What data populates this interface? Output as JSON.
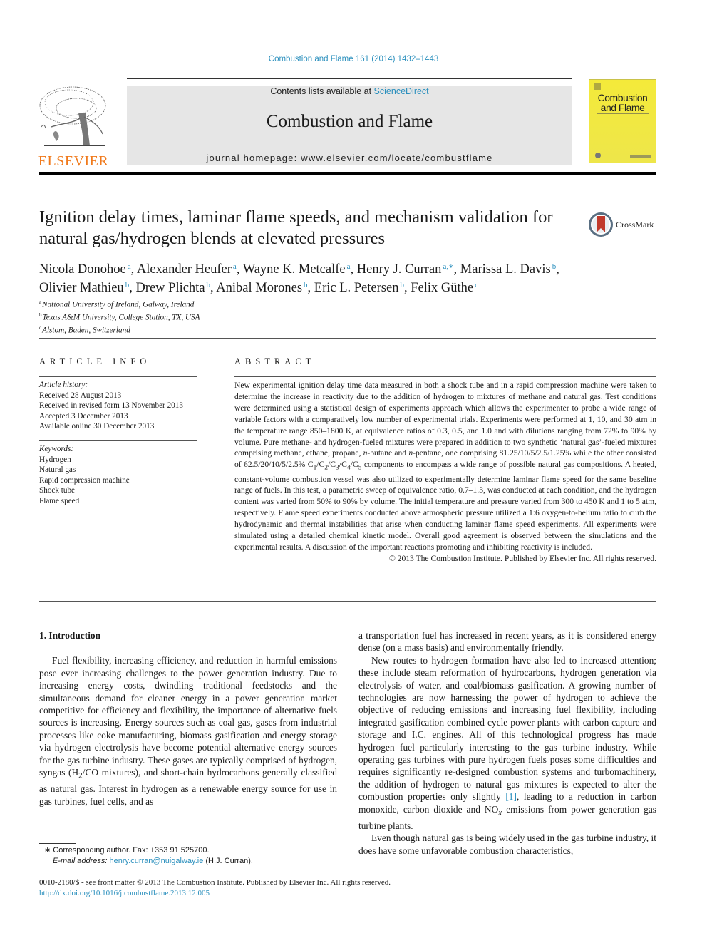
{
  "header": {
    "citation": "Combustion and Flame 161 (2014) 1432–1443",
    "publisher_logo_text": "ELSEVIER",
    "contents_prefix": "Contents lists available at ",
    "contents_link": "ScienceDirect",
    "journal_title": "Combustion and Flame",
    "homepage": "journal homepage: www.elsevier.com/locate/combustflame",
    "cover_title_line1": "Combustion",
    "cover_title_line2": "and Flame",
    "crossmark_label": "CrossMark",
    "colors": {
      "link": "#2a8fbd",
      "elsevier_orange": "#f07a1c",
      "cover_yellow": "#f4ea3a",
      "masthead_gray": "#e6e6e6"
    }
  },
  "article": {
    "title": "Ignition delay times, laminar flame speeds, and mechanism validation for natural gas/hydrogen blends at elevated pressures",
    "authors": [
      {
        "name": "Nicola Donohoe",
        "aff": "a",
        "sep": ", "
      },
      {
        "name": "Alexander Heufer",
        "aff": "a",
        "sep": ", "
      },
      {
        "name": "Wayne K. Metcalfe",
        "aff": "a",
        "sep": ", "
      },
      {
        "name": "Henry J. Curran",
        "aff": "a,∗",
        "sep": ", "
      },
      {
        "name": "Marissa L. Davis",
        "aff": "b",
        "sep": ","
      },
      {
        "name": "Olivier Mathieu",
        "aff": "b",
        "sep": ", "
      },
      {
        "name": "Drew Plichta",
        "aff": "b",
        "sep": ", "
      },
      {
        "name": "Anibal Morones",
        "aff": "b",
        "sep": ", "
      },
      {
        "name": "Eric L. Petersen",
        "aff": "b",
        "sep": ", "
      },
      {
        "name": "Felix Güthe",
        "aff": "c",
        "sep": ""
      }
    ],
    "affiliations": [
      {
        "key": "a",
        "text": "National University of Ireland, Galway, Ireland"
      },
      {
        "key": "b",
        "text": "Texas A&M University, College Station, TX, USA"
      },
      {
        "key": "c",
        "text": "Alstom, Baden, Switzerland"
      }
    ]
  },
  "article_info": {
    "heading": "ARTICLE INFO",
    "history_label": "Article history:",
    "history": [
      "Received 28 August 2013",
      "Received in revised form 13 November 2013",
      "Accepted 3 December 2013",
      "Available online 30 December 2013"
    ],
    "keywords_label": "Keywords:",
    "keywords": [
      "Hydrogen",
      "Natural gas",
      "Rapid compression machine",
      "Shock tube",
      "Flame speed"
    ]
  },
  "abstract": {
    "heading": "ABSTRACT",
    "text_part1": "New experimental ignition delay time data measured in both a shock tube and in a rapid compression machine were taken to determine the increase in reactivity due to the addition of hydrogen to mixtures of methane and natural gas. Test conditions were determined using a statistical design of experiments approach which allows the experimenter to probe a wide range of variable factors with a comparatively low number of experimental trials. Experiments were performed at 1, 10, and 30 atm in the temperature range 850–1800 K, at equivalence ratios of 0.3, 0.5, and 1.0 and with dilutions ranging from 72% to 90% by volume. Pure methane- and hydrogen-fueled mixtures were prepared in addition to two synthetic ‘natural gas’-fueled mixtures comprising methane, ethane, propane, ",
    "n1": "n",
    "text_part2": "-butane and ",
    "n2": "n",
    "text_part3": "-pentane, one comprising 81.25/10/5/2.5/1.25% while the other consisted of 62.5/20/10/5/2.5% C",
    "components": [
      "1",
      "2",
      "3",
      "4",
      "5"
    ],
    "text_part4": " components to encompass a wide range of possible natural gas compositions. A heated, constant-volume combustion vessel was also utilized to experimentally determine laminar flame speed for the same baseline range of fuels. In this test, a parametric sweep of equivalence ratio, 0.7–1.3, was conducted at each condition, and the hydrogen content was varied from 50% to 90% by volume. The initial temperature and pressure varied from 300 to 450 K and 1 to 5 atm, respectively. Flame speed experiments conducted above atmospheric pressure utilized a 1:6 oxygen-to-helium ratio to curb the hydrodynamic and thermal instabilities that arise when conducting laminar flame speed experiments. All experiments were simulated using a detailed chemical kinetic model. Overall good agreement is observed between the simulations and the experimental results. A discussion of the important reactions promoting and inhibiting reactivity is included.",
    "copyright": "© 2013 The Combustion Institute. Published by Elsevier Inc. All rights reserved."
  },
  "body": {
    "section_heading": "1. Introduction",
    "left_p1_a": "Fuel flexibility, increasing efficiency, and reduction in harmful emissions pose ever increasing challenges to the power generation industry. Due to increasing energy costs, dwindling traditional feedstocks and the simultaneous demand for cleaner energy in a power generation market competitive for efficiency and flexibility, the importance of alternative fuels sources is increasing. Energy sources such as coal gas, gases from industrial processes like coke manufacturing, biomass gasification and energy storage via hydrogen electrolysis have become potential alternative energy sources for the gas turbine industry. These gases are typically comprised of hydrogen, syngas (H",
    "left_p1_sub": "2",
    "left_p1_b": "/CO mixtures), and short-chain hydrocarbons generally classified as natural gas. Interest in hydrogen as a renewable energy source for use in gas turbines, fuel cells, and as",
    "right_p1": "a transportation fuel has increased in recent years, as it is considered energy dense (on a mass basis) and environmentally friendly.",
    "right_p2_a": "New routes to hydrogen formation have also led to increased attention; these include steam reformation of hydrocarbons, hydrogen generation via electrolysis of water, and coal/biomass gasification. A growing number of technologies are now harnessing the power of hydrogen to achieve the objective of reducing emissions and increasing fuel flexibility, including integrated gasification combined cycle power plants with carbon capture and storage and I.C. engines. All of this technological progress has made hydrogen fuel particularly interesting to the gas turbine industry. While operating gas turbines with pure hydrogen fuels poses some difficulties and requires significantly re-designed combustion systems and turbomachinery, the addition of hydrogen to natural gas mixtures is expected to alter the combustion properties only slightly ",
    "ref1": "[1]",
    "right_p2_b": ", leading to a reduction in carbon monoxide, carbon dioxide and NO",
    "nox_sub": "x",
    "right_p2_c": " emissions from power generation gas turbine plants.",
    "right_p3": "Even though natural gas is being widely used in the gas turbine industry, it does have some unfavorable combustion characteristics,"
  },
  "footnotes": {
    "star": "∗",
    "corresponding": "Corresponding author. Fax: +353 91 525700.",
    "email_label": "E-mail address:",
    "email": "henry.curran@nuigalway.ie",
    "email_suffix": " (H.J. Curran)."
  },
  "footer": {
    "issn": "0010-2180/$ - see front matter © 2013 The Combustion Institute. Published by Elsevier Inc. All rights reserved.",
    "doi": "http://dx.doi.org/10.1016/j.combustflame.2013.12.005"
  }
}
